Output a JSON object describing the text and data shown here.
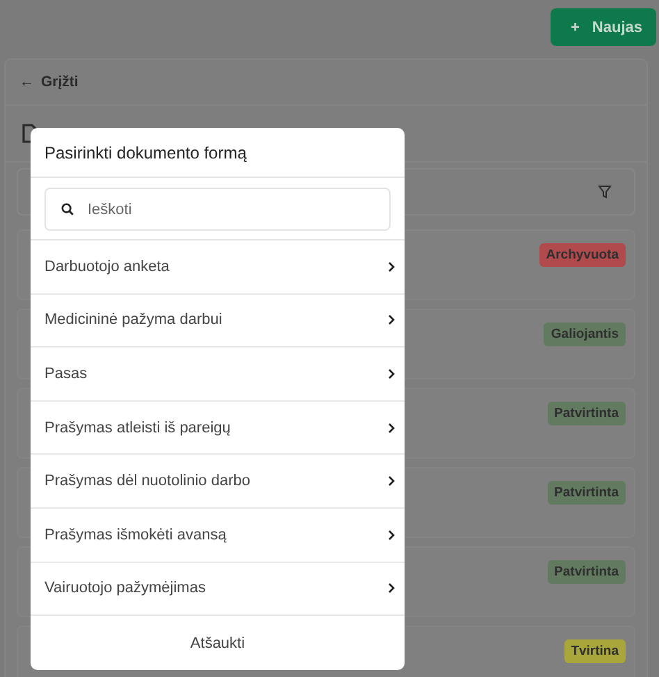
{
  "toolbar": {
    "new_button": {
      "icon": "+",
      "label": "Naujas"
    }
  },
  "back_link": {
    "icon": "←",
    "label": "Grįžti"
  },
  "documents": [
    {
      "status": "Archyvuota",
      "color": "#b04a4d"
    },
    {
      "status": "Galiojantis",
      "color": "#627a60"
    },
    {
      "status": "Patvirtinta",
      "color": "#627a60"
    },
    {
      "status": "Patvirtinta",
      "color": "#627a60"
    },
    {
      "status": "Patvirtinta",
      "color": "#627a60"
    },
    {
      "status": "Tvirtina",
      "color": "#a9a63c"
    }
  ],
  "modal": {
    "title": "Pasirinkti dokumento formą",
    "search": {
      "placeholder": "Ieškoti"
    },
    "items": [
      {
        "label": "Darbuotojo anketa"
      },
      {
        "label": "Medicininė pažyma darbui"
      },
      {
        "label": "Pasas"
      },
      {
        "label": "Prašymas atleisti iš pareigų"
      },
      {
        "label": "Prašymas dėl nuotolinio darbo"
      },
      {
        "label": "Prašymas išmokėti avansą"
      },
      {
        "label": "Vairuotojo pažymėjimas"
      }
    ],
    "cancel_button": "Atšaukti"
  }
}
